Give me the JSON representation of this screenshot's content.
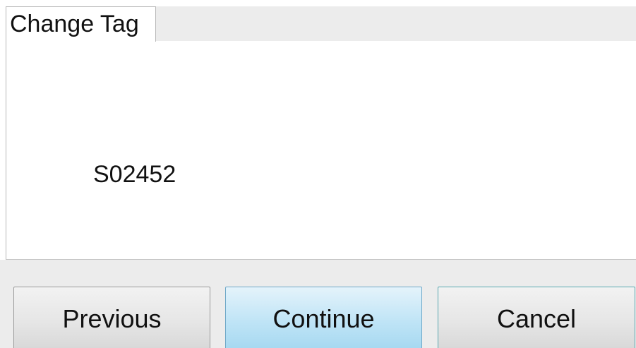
{
  "dialog": {
    "tab_label": "Change Tag",
    "tag_value": "S02452"
  },
  "buttons": {
    "previous_label": "Previous",
    "continue_label": "Continue",
    "cancel_label": "Cancel"
  },
  "colors": {
    "continue_accent": "#bfe4f6",
    "focus_border": "#5aa8b0"
  }
}
